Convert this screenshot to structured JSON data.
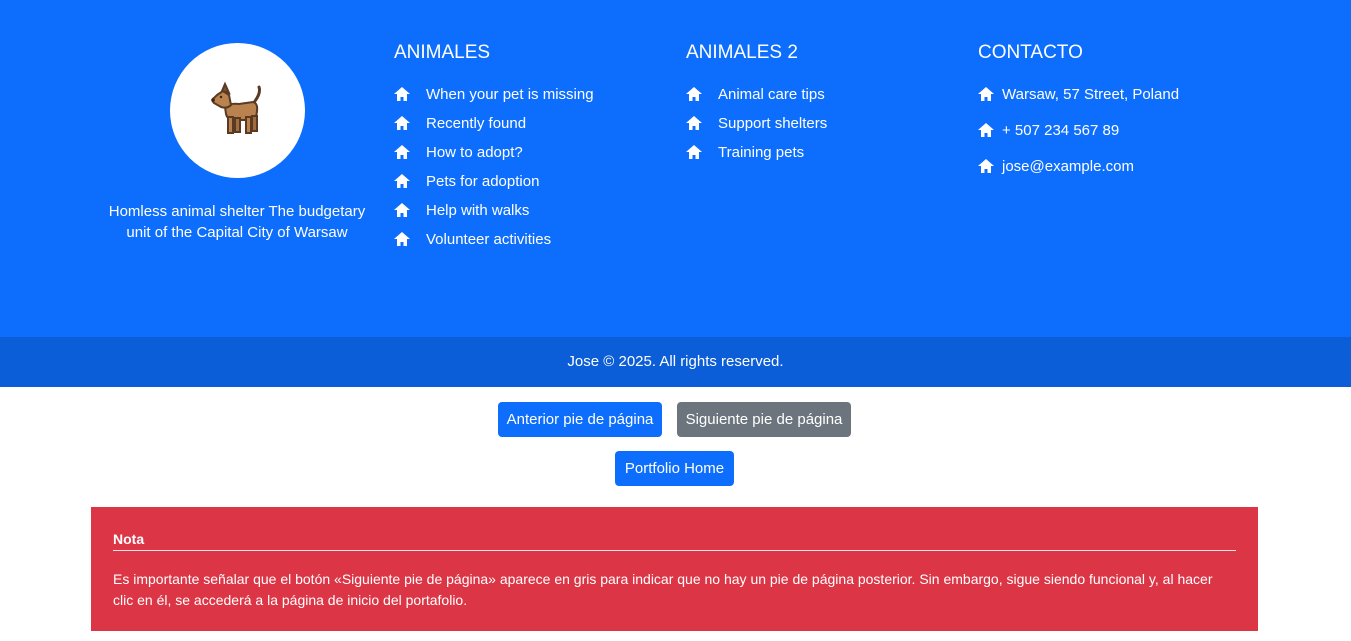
{
  "brand": {
    "logo_icon": "dog-icon",
    "text": "Homless animal shelter The budgetary unit of the Capital City of Warsaw"
  },
  "col1": {
    "title": "ANIMALES",
    "items": [
      {
        "label": "When your pet is missing"
      },
      {
        "label": "Recently found"
      },
      {
        "label": "How to adopt?"
      },
      {
        "label": "Pets for adoption"
      },
      {
        "label": "Help with walks"
      },
      {
        "label": "Volunteer activities"
      }
    ]
  },
  "col2": {
    "title": "ANIMALES 2",
    "items": [
      {
        "label": "Animal care tips"
      },
      {
        "label": "Support shelters"
      },
      {
        "label": "Training pets"
      }
    ]
  },
  "col3": {
    "title": "CONTACTO",
    "items": [
      {
        "label": "Warsaw, 57 Street, Poland"
      },
      {
        "label": "+ 507 234 567 89"
      },
      {
        "label": "jose@example.com"
      }
    ]
  },
  "copyright": "Jose © 2025. All rights reserved.",
  "buttons": {
    "prev": "Anterior pie de página",
    "next": "Siguiente pie de página",
    "home": "Portfolio Home"
  },
  "note": {
    "title": "Nota",
    "body": "Es importante señalar que el botón «Siguiente pie de página» aparece en gris para indicar que no hay un pie de página posterior. Sin embargo, sigue siendo funcional y, al hacer clic en él, se accederá a la página de inicio del portafolio."
  },
  "colors": {
    "primary": "#0d6efd",
    "primary_dark": "#0b5ed7",
    "secondary": "#6c757d",
    "danger": "#dc3545"
  }
}
